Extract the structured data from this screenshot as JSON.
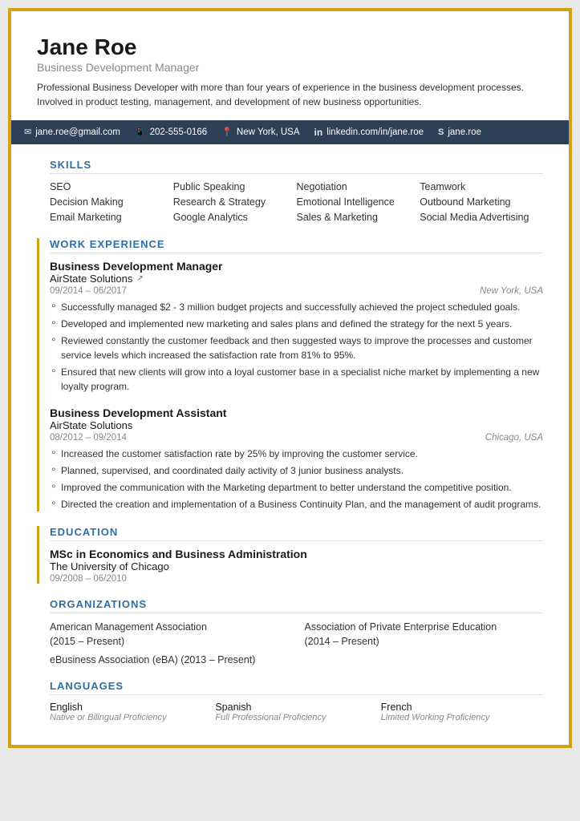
{
  "header": {
    "name": "Jane Roe",
    "job_title": "Business Development Manager",
    "summary": "Professional Business Developer with more than four years of experience in the business development processes. Involved in product testing, management, and development of new business opportunities."
  },
  "contact": {
    "email": "jane.roe@gmail.com",
    "phone": "202-555-0166",
    "location": "New York, USA",
    "linkedin": "linkedin.com/in/jane.roe",
    "skype": "jane.roe"
  },
  "skills": {
    "title": "SKILLS",
    "items": [
      [
        "SEO",
        "Public Speaking",
        "Negotiation",
        "Teamwork"
      ],
      [
        "Decision Making",
        "Research & Strategy",
        "Emotional Intelligence",
        "Outbound Marketing"
      ],
      [
        "Email Marketing",
        "Google Analytics",
        "Sales & Marketing",
        "Social Media Advertising"
      ]
    ]
  },
  "work_experience": {
    "title": "WORK EXPERIENCE",
    "entries": [
      {
        "title": "Business Development Manager",
        "company": "AirState Solutions",
        "has_link": true,
        "date_range": "09/2014 – 06/2017",
        "location": "New York, USA",
        "bullets": [
          "Successfully managed $2 - 3 million budget projects and successfully achieved the project scheduled goals.",
          "Developed and implemented new marketing and sales plans and defined the strategy for the next 5 years.",
          "Reviewed constantly the customer feedback and then suggested ways to improve the processes and customer service levels which increased the satisfaction rate from 81% to 95%.",
          "Ensured that new clients will grow into a loyal customer base in a specialist niche market by implementing a new loyalty program."
        ]
      },
      {
        "title": "Business Development Assistant",
        "company": "AirState Solutions",
        "has_link": false,
        "date_range": "08/2012 – 09/2014",
        "location": "Chicago, USA",
        "bullets": [
          "Increased the customer satisfaction rate by 25% by improving the customer service.",
          "Planned, supervised, and coordinated daily activity of 3 junior business analysts.",
          "Improved the communication with the Marketing department to better understand the competitive position.",
          "Directed the creation and implementation of a Business Continuity Plan, and the management of audit programs."
        ]
      }
    ]
  },
  "education": {
    "title": "EDUCATION",
    "entries": [
      {
        "degree": "MSc in Economics and Business Administration",
        "school": "The University of Chicago",
        "date_range": "09/2008 – 06/2010"
      }
    ]
  },
  "organizations": {
    "title": "ORGANIZATIONS",
    "items_grid": [
      {
        "name": "American Management Association",
        "years": "(2015 – Present)"
      },
      {
        "name": "Association of Private Enterprise Education",
        "years": "(2014 – Present)"
      }
    ],
    "single_item": "eBusiness Association (eBA) (2013 – Present)"
  },
  "languages": {
    "title": "LANGUAGES",
    "items": [
      {
        "name": "English",
        "level": "Native or Bilingual Proficiency"
      },
      {
        "name": "Spanish",
        "level": "Full Professional Proficiency"
      },
      {
        "name": "French",
        "level": "Limited Working Proficiency"
      }
    ]
  },
  "icons": {
    "email": "✉",
    "phone": "📱",
    "location": "📍",
    "linkedin": "in",
    "skype": "S",
    "external_link": "↗"
  }
}
